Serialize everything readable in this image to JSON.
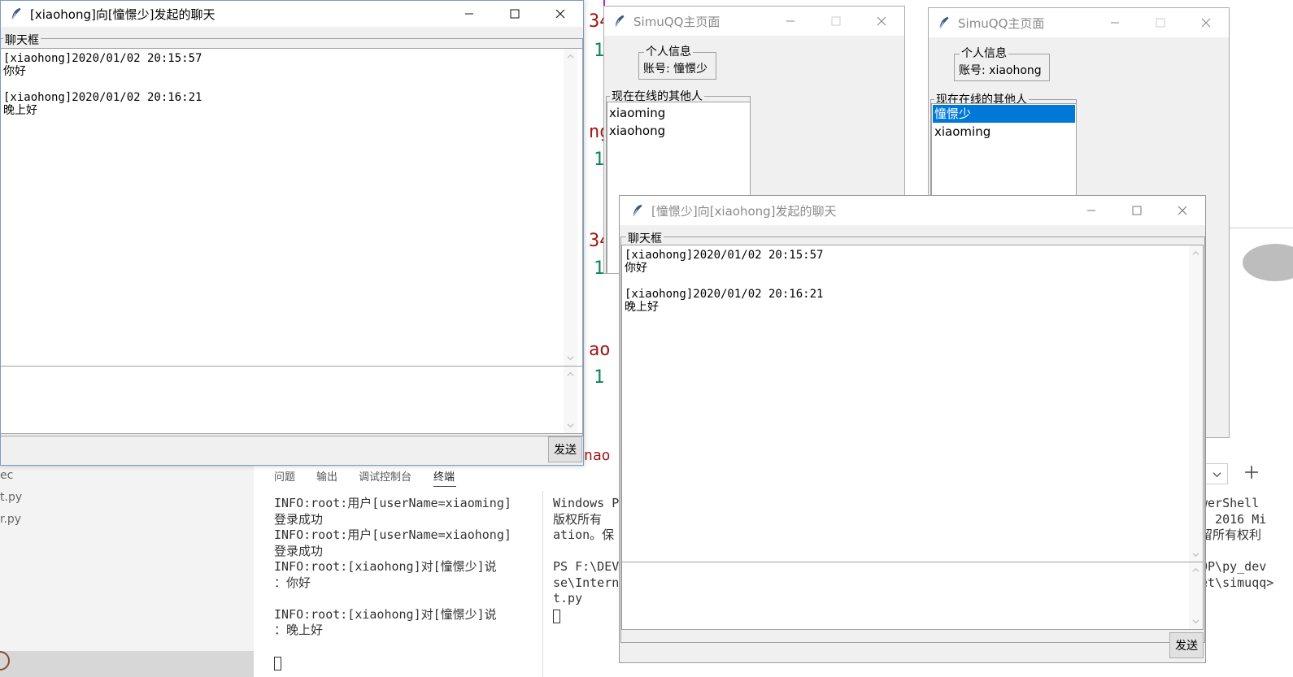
{
  "background": {
    "explorer_items": [
      "ec",
      "t.py",
      "r.py"
    ],
    "panel_tabs": [
      "问题",
      "输出",
      "调试控制台",
      "终端"
    ],
    "terminal_left_lines": [
      "INFO:root:用户[userName=xiaoming]",
      "登录成功",
      "INFO:root:用户[userName=xiaohong]",
      "登录成功",
      "INFO:root:[xiaohong]对[憧憬少]说",
      "：你好",
      "",
      "INFO:root:[xiaohong]对[憧憬少]说",
      "：晚上好"
    ],
    "terminal_mid_lines": [
      "Windows P",
      "版权所有",
      "ation。保",
      "",
      "PS F:\\DEV",
      "se\\Intern",
      "t.py"
    ],
    "terminal_right_lines": [
      "werShell",
      ") 2016 Mi",
      "留所有权利",
      "",
      "OP\\py_dev",
      "et\\simuqq>"
    ],
    "code_fragments": [
      "34",
      "1",
      "ng",
      "1",
      "34",
      "1",
      "ao",
      "1",
      "nao"
    ],
    "colors": {
      "code_red": "#a31515",
      "code_green": "#098658",
      "selection": "#0078d7"
    }
  },
  "chat_window_left": {
    "title": "[xiaohong]向[憧憬少]发起的聊天",
    "frame_label": "聊天框",
    "messages": [
      {
        "header": "[xiaohong]2020/01/02 20:15:57",
        "text": "你好"
      },
      {
        "header": "[xiaohong]2020/01/02 20:16:21",
        "text": "晚上好"
      }
    ],
    "send_label": "发送"
  },
  "main_window_1": {
    "title": "SimuQQ主页面",
    "profile_frame_label": "个人信息",
    "account_label": "账号: 憧憬少",
    "online_frame_label": "现在在线的其他人",
    "online_users": [
      "xiaoming",
      "xiaohong"
    ]
  },
  "main_window_2": {
    "title": "SimuQQ主页面",
    "profile_frame_label": "个人信息",
    "account_label": "账号: xiaohong",
    "online_frame_label": "现在在线的其他人",
    "online_users": [
      "憧憬少",
      "xiaoming"
    ],
    "selected_index": 0
  },
  "chat_window_right": {
    "title": "[憧憬少]向[xiaohong]发起的聊天",
    "frame_label": "聊天框",
    "messages": [
      {
        "header": "[xiaohong]2020/01/02 20:15:57",
        "text": "你好"
      },
      {
        "header": "[xiaohong]2020/01/02 20:16:21",
        "text": "晚上好"
      }
    ],
    "send_label": "发送"
  }
}
